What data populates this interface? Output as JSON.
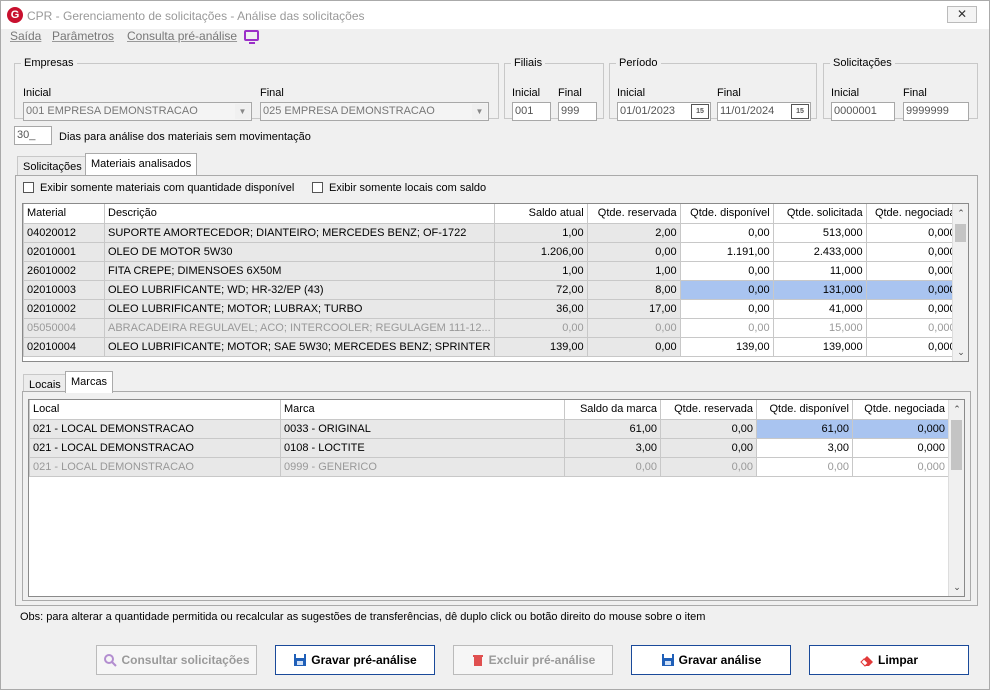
{
  "window": {
    "title": "CPR - Gerenciamento de solicitações - Análise das solicitações",
    "app_icon_letter": "G",
    "close_symbol": "✕"
  },
  "menu": {
    "items": [
      "Saída",
      "Parâmetros",
      "Consulta pré-análise"
    ]
  },
  "filters": {
    "empresas": {
      "legend": "Empresas",
      "inicial_label": "Inicial",
      "inicial_value": "001 EMPRESA DEMONSTRACAO",
      "final_label": "Final",
      "final_value": "025 EMPRESA DEMONSTRACAO"
    },
    "filiais": {
      "legend": "Filiais",
      "inicial_label": "Inicial",
      "inicial_value": "001",
      "final_label": "Final",
      "final_value": "999"
    },
    "periodo": {
      "legend": "Período",
      "inicial_label": "Inicial",
      "inicial_value": "01/01/2023",
      "final_label": "Final",
      "final_value": "11/01/2024",
      "calendar_glyph": "15"
    },
    "solicitacoes": {
      "legend": "Solicitações",
      "inicial_label": "Inicial",
      "inicial_value": "0000001",
      "final_label": "Final",
      "final_value": "9999999"
    }
  },
  "dias": {
    "value": "30_",
    "label": "Dias para análise dos materiais sem movimentação"
  },
  "top_tabs": [
    "Solicitações",
    "Materiais analisados"
  ],
  "checkboxes": {
    "qtd_disponivel": "Exibir somente materiais com quantidade disponível",
    "locais_saldo": "Exibir somente locais com saldo"
  },
  "materials_grid": {
    "headers": [
      "Material",
      "Descrição",
      "Saldo atual",
      "Qtde. reservada",
      "Qtde. disponível",
      "Qtde. solicitada",
      "Qtde. negociada"
    ],
    "rows": [
      [
        "04020012",
        "SUPORTE AMORTECEDOR; DIANTEIRO; MERCEDES BENZ; OF-1722",
        "1,00",
        "2,00",
        "0,00",
        "513,000",
        "0,000"
      ],
      [
        "02010001",
        "OLEO DE MOTOR 5W30",
        "1.206,00",
        "0,00",
        "1.191,00",
        "2.433,000",
        "0,000"
      ],
      [
        "26010002",
        "FITA CREPE; DIMENSOES 6X50M",
        "1,00",
        "1,00",
        "0,00",
        "11,000",
        "0,000"
      ],
      [
        "02010003",
        "OLEO LUBRIFICANTE; WD; HR-32/EP (43)",
        "72,00",
        "8,00",
        "0,00",
        "131,000",
        "0,000"
      ],
      [
        "02010002",
        "OLEO LUBRIFICANTE; MOTOR; LUBRAX; TURBO",
        "36,00",
        "17,00",
        "0,00",
        "41,000",
        "0,000"
      ],
      [
        "05050004",
        "ABRACADEIRA REGULAVEL; ACO; INTERCOOLER; REGULAGEM 111-12...",
        "0,00",
        "0,00",
        "0,00",
        "15,000",
        "0,000"
      ],
      [
        "02010004",
        "OLEO LUBRIFICANTE; MOTOR; SAE 5W30; MERCEDES BENZ; SPRINTER",
        "139,00",
        "0,00",
        "139,00",
        "139,000",
        "0,000"
      ]
    ]
  },
  "bottom_tabs": [
    "Locais",
    "Marcas"
  ],
  "brands_grid": {
    "headers": [
      "Local",
      "Marca",
      "Saldo da marca",
      "Qtde. reservada",
      "Qtde. disponível",
      "Qtde. negociada"
    ],
    "rows": [
      [
        "021 - LOCAL DEMONSTRACAO",
        "0033 - ORIGINAL",
        "61,00",
        "0,00",
        "61,00",
        "0,000"
      ],
      [
        "021 - LOCAL DEMONSTRACAO",
        "0108 - LOCTITE",
        "3,00",
        "0,00",
        "3,00",
        "0,000"
      ],
      [
        "021 - LOCAL DEMONSTRACAO",
        "0999 - GENERICO",
        "0,00",
        "0,00",
        "0,00",
        "0,000"
      ]
    ]
  },
  "obs": "Obs: para alterar a quantidade permitida ou recalcular as sugestões de transferências, dê duplo click ou botão direito do mouse sobre o item",
  "buttons": {
    "consultar": "Consultar solicitações",
    "gravar_pre": "Gravar pré-análise",
    "excluir_pre": "Excluir pré-análise",
    "gravar": "Gravar análise",
    "limpar": "Limpar"
  },
  "scroll_glyphs": {
    "up": "⌃",
    "down": "⌄"
  },
  "colors": {
    "selection": "#a9c4f0",
    "app_icon": "#c8102e",
    "monitor_icon": "#9b30c8"
  }
}
